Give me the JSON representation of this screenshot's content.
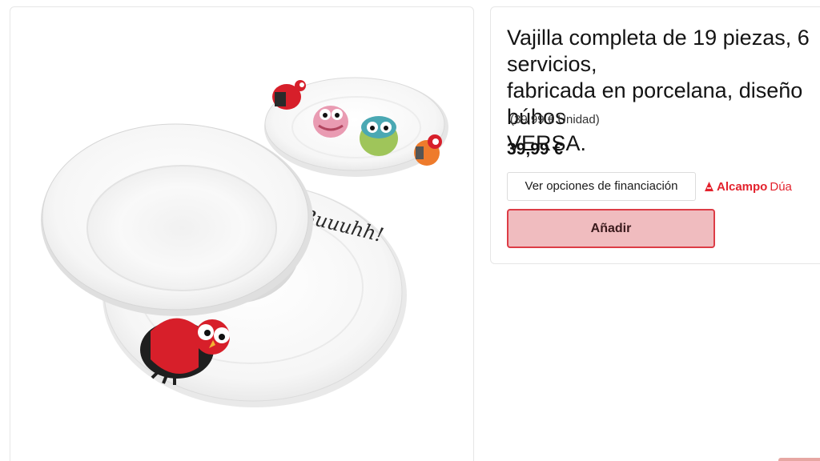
{
  "product": {
    "title": "Vajilla completa de 19 piezas, 6 servicios,\nfabricada en porcelana, diseño búhos\nVERSA.",
    "unit_price": "(39,99 € Unidad)",
    "price": "39,99 €",
    "financing_label": "Ver opciones de financiación",
    "brand_name": "Alcampo",
    "brand_sub": "Dúa",
    "add_label": "Añadir",
    "plate_script": "Buuuhh!"
  },
  "colors": {
    "accent": "#dd3c46",
    "add_fill": "#f0bcbf",
    "brand": "#e3222d",
    "border": "#e6e6e6"
  }
}
